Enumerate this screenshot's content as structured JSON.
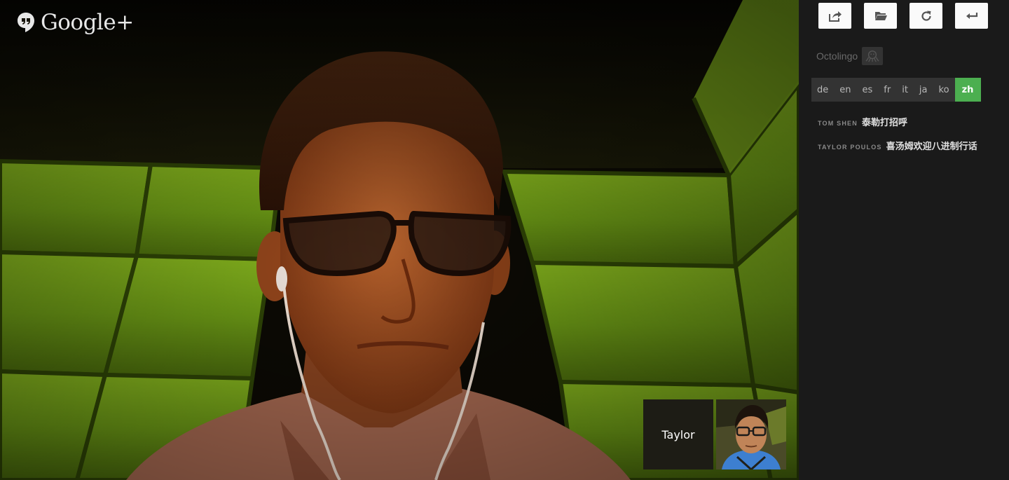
{
  "brand": {
    "name": "Google+"
  },
  "video": {
    "participant_label": "Taylor"
  },
  "toolbar": {
    "buttons": [
      {
        "icon": "share-icon",
        "label": "Share"
      },
      {
        "icon": "folder-icon",
        "label": "Open"
      },
      {
        "icon": "refresh-icon",
        "label": "Refresh"
      },
      {
        "icon": "back-icon",
        "label": "Back"
      }
    ]
  },
  "app": {
    "name": "Octolingo",
    "logo_icon": "octopus-icon"
  },
  "languages": {
    "items": [
      "de",
      "en",
      "es",
      "fr",
      "it",
      "ja",
      "ko",
      "zh"
    ],
    "selected": "zh",
    "accent": "#4caf50"
  },
  "messages": [
    {
      "sender": "Tom Shen",
      "text": "泰勒打招呼"
    },
    {
      "sender": "Taylor Poulos",
      "text": "喜汤姆欢迎八进制行话"
    }
  ]
}
